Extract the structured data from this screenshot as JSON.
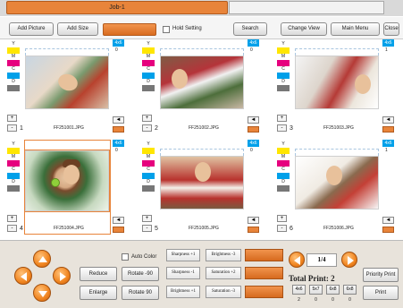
{
  "window": {
    "job_title": "Job-1"
  },
  "toolbar": {
    "add_picture": "Add Picture",
    "add_size": "Add Size",
    "hold_setting": "Hold Setting",
    "search": "Search",
    "change_view": "Change View",
    "main_menu": "Main Menu",
    "close": "Close"
  },
  "cmyk_labels": {
    "y": "Y",
    "m": "M",
    "c": "C",
    "d": "D"
  },
  "pm": {
    "plus": "+",
    "minus": "-"
  },
  "rotate_icon": "◄",
  "photos": [
    {
      "num": "1",
      "file": "FF251001.JPG",
      "size": "4x6",
      "qty": "0",
      "selected": false
    },
    {
      "num": "2",
      "file": "FF251002.JPG",
      "size": "4x6",
      "qty": "0",
      "selected": false
    },
    {
      "num": "3",
      "file": "FF251003.JPG",
      "size": "4x6",
      "qty": "1",
      "selected": false
    },
    {
      "num": "4",
      "file": "FF251004.JPG",
      "size": "4x6",
      "qty": "0",
      "selected": true
    },
    {
      "num": "5",
      "file": "FF251005.JPG",
      "size": "4x6",
      "qty": "0",
      "selected": false
    },
    {
      "num": "6",
      "file": "FF251006.JPG",
      "size": "4x6",
      "qty": "1",
      "selected": false
    }
  ],
  "bottom": {
    "auto_color": "Auto Color",
    "reduce": "Reduce",
    "rotate_neg": "Rotate -90",
    "enlarge": "Enlarge",
    "rotate_pos": "Rotate 90",
    "sharpness_plus": "Sharpness +1",
    "sharpness_minus": "Sharpness -1",
    "brightness_plus": "Brightness +1",
    "brightness_minus": "Brightness -3",
    "saturation_plus": "Saturation +2",
    "saturation_minus": "Saturation -3",
    "page": "1/4",
    "total_print": "Total Print: 2",
    "priority_print": "Priority Print",
    "print": "Print",
    "sizes": [
      {
        "label": "4x6",
        "count": "2"
      },
      {
        "label": "5x7",
        "count": "0"
      },
      {
        "label": "6x8",
        "count": "0"
      },
      {
        "label": "6x8",
        "count": "0"
      }
    ]
  },
  "colors": {
    "accent": "#e8843a",
    "cyan": "#00a0e9",
    "magenta": "#e6007e",
    "yellow": "#ffe600"
  }
}
